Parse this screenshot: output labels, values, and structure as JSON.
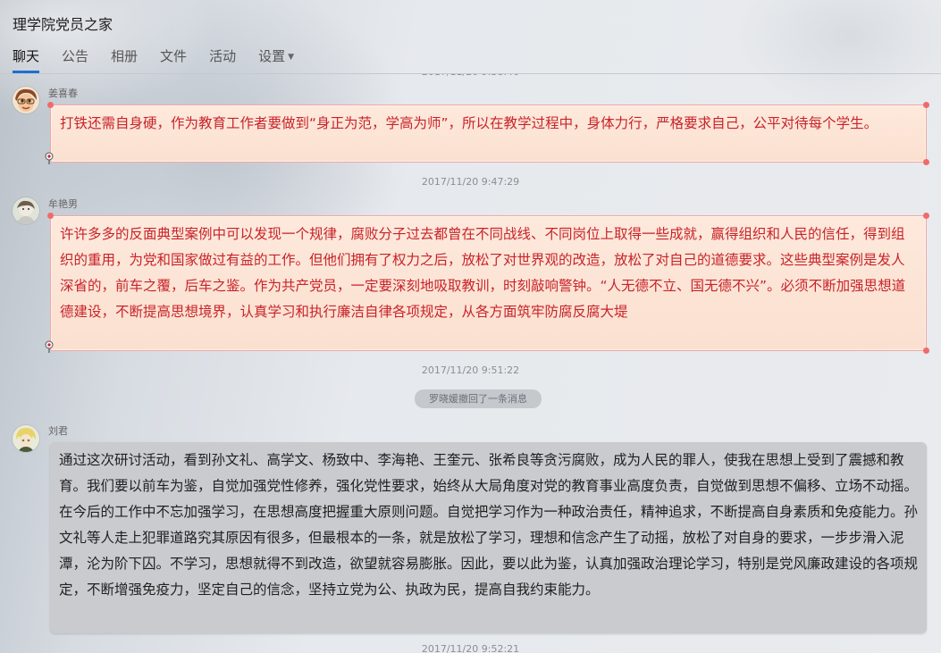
{
  "app": {
    "title": "理学院党员之家"
  },
  "tabs": [
    {
      "label": "聊天",
      "active": true
    },
    {
      "label": "公告"
    },
    {
      "label": "相册"
    },
    {
      "label": "文件"
    },
    {
      "label": "活动"
    },
    {
      "label": "设置"
    }
  ],
  "messages": [
    {
      "sender": "姜喜春",
      "text": "打铁还需自身硬，作为教育工作者要做到“身正为范，学高为师”，所以在教学过程中，身体力行，严格要求自己，公平对待每个学生。",
      "time": "2017/11/20 9:47:29"
    },
    {
      "sender": "牟艳男",
      "text": "许许多多的反面典型案例中可以发现一个规律，腐败分子过去都曾在不同战线、不同岗位上取得一些成就，赢得组织和人民的信任，得到组织的重用，为党和国家做过有益的工作。但他们拥有了权力之后，放松了对世界观的改造，放松了对自己的道德要求。这些典型案例是发人深省的，前车之覆，后车之鉴。作为共产党员，一定要深刻地吸取教训，时刻敲响警钟。“人无德不立、国无德不兴”。必须不断加强思想道德建设，不断提高思想境界，认真学习和执行廉洁自律各项规定，从各方面筑牢防腐反腐大堤",
      "time": "2017/11/20 9:51:22"
    },
    {
      "notice": "罗晓媛撤回了一条消息"
    },
    {
      "sender": "刘君",
      "text": "通过这次研讨活动，看到孙文礼、高学文、杨致中、李海艳、王奎元、张希良等贪污腐败，成为人民的罪人，使我在思想上受到了震撼和教育。我们要以前车为鉴，自觉加强党性修养，强化党性要求，始终从大局角度对党的教育事业高度负责，自觉做到思想不偏移、立场不动摇。在今后的工作中不忘加强学习，在思想高度把握重大原则问题。自觉把学习作为一种政治责任，精神追求，不断提高自身素质和免疫能力。孙文礼等人走上犯罪道路究其原因有很多，但最根本的一条，就是放松了学习，理想和信念产生了动摇，放松了对自身的要求，一步步滑入泥潭，沦为阶下囚。不学习，思想就得不到改造，欲望就容易膨胀。因此，要以此为鉴，认真加强政治理论学习，特别是党风廉政建设的各项规定，不断增强免疫力，坚定自己的信念，坚持立党为公、执政为民，提高自我约束能力。",
      "time": "2017/11/20 9:52:21"
    }
  ],
  "colors": {
    "accent": "#1e6fcf",
    "highlight_text": "#c8232a",
    "highlight_bg": "#fde9dc"
  },
  "icons": {
    "settings_dropdown": "caret-down-icon",
    "bubble_pin": "pin-icon"
  }
}
